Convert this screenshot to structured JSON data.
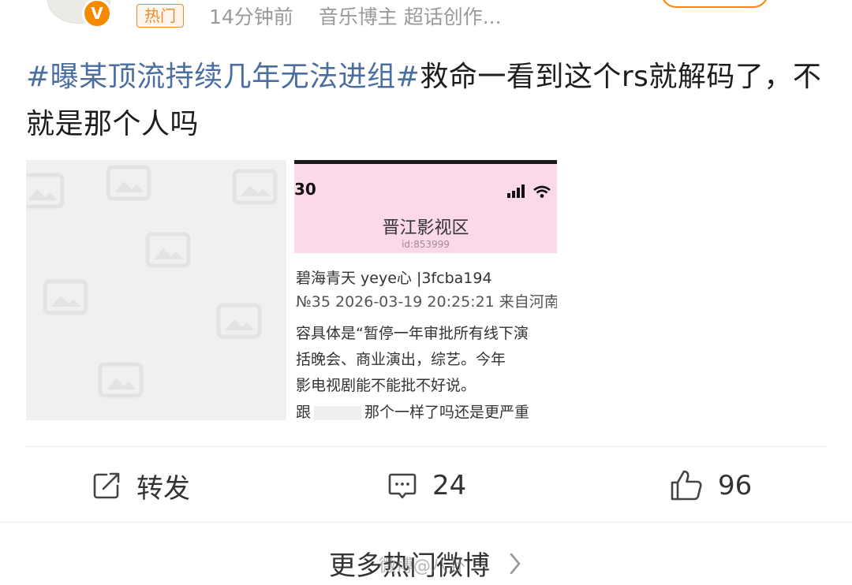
{
  "header": {
    "hot_badge": "热门",
    "time_ago": "14分钟前",
    "user_tags": "音乐博主 超话创作..."
  },
  "post": {
    "hashtag": "#曝某顶流持续几年无法进组#",
    "text": "救命一看到这个rs就解码了，不就是那个人吗"
  },
  "screenshot": {
    "time": "30",
    "title": "晋江影视区",
    "id": "id:853999",
    "user_line": "碧海青天 yeye心 |3fcba194",
    "post_line": "№35  2026-03-19 20:25:21 来自河南",
    "content_1": "容具体是“暂停一年审批所有线下演",
    "content_2": "括晚会、商业演出，综艺。今年",
    "content_3": "影电视剧能不能批不好说。",
    "content_4_a": "跟",
    "content_4_b": "那个一样了吗还是更严重"
  },
  "actions": {
    "repost_label": "转发",
    "comment_count": "24",
    "like_count": "96"
  },
  "footer": {
    "more_label": "更多热门微博",
    "watermark": "微博@八卦"
  },
  "colors": {
    "hashtag": "#4a6ea0",
    "hot_badge": "#f08a2c",
    "verified_badge": "#f58a00",
    "screenshot_header": "#fcd9ea"
  },
  "icons": [
    "verified-v-icon",
    "repost-icon",
    "comment-icon",
    "like-icon",
    "chevron-right-icon",
    "image-placeholder-icon",
    "signal-icon",
    "wifi-icon"
  ]
}
